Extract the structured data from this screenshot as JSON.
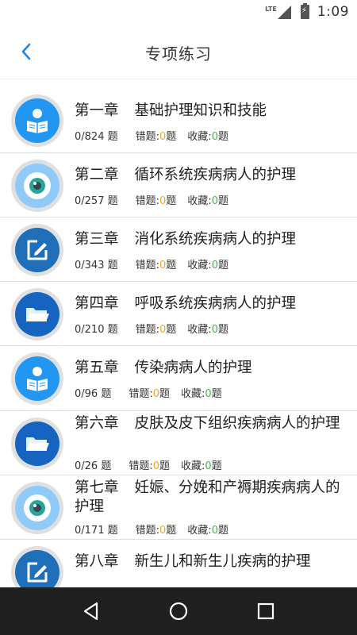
{
  "status_bar": {
    "network": "LTE",
    "time": "1:09"
  },
  "header": {
    "title": "专项练习",
    "back_icon": "chevron-left-icon",
    "accent_color": "#1e88e5"
  },
  "chapters": [
    {
      "chapter": "第一章",
      "title": "基础护理知识和技能",
      "progress": "0/824 题",
      "wrong_label": "错题:",
      "wrong_count": "0",
      "wrong_suffix": "题",
      "fav_label": "收藏:",
      "fav_count": "0",
      "fav_suffix": "题",
      "icon": "reading-book-icon"
    },
    {
      "chapter": "第二章",
      "title": "循环系统疾病病人的护理",
      "progress": "0/257 题",
      "wrong_label": "错题:",
      "wrong_count": "0",
      "wrong_suffix": "题",
      "fav_label": "收藏:",
      "fav_count": "0",
      "fav_suffix": "题",
      "icon": "eye-icon"
    },
    {
      "chapter": "第三章",
      "title": "消化系统疾病病人的护理",
      "progress": "0/343 题",
      "wrong_label": "错题:",
      "wrong_count": "0",
      "wrong_suffix": "题",
      "fav_label": "收藏:",
      "fav_count": "0",
      "fav_suffix": "题",
      "icon": "edit-icon"
    },
    {
      "chapter": "第四章",
      "title": "呼吸系统疾病病人的护理",
      "progress": "0/210 题",
      "wrong_label": "错题:",
      "wrong_count": "0",
      "wrong_suffix": "题",
      "fav_label": "收藏:",
      "fav_count": "0",
      "fav_suffix": "题",
      "icon": "folder-icon"
    },
    {
      "chapter": "第五章",
      "title": "传染病病人的护理",
      "progress": "0/96 题",
      "wrong_label": "错题:",
      "wrong_count": "0",
      "wrong_suffix": "题",
      "fav_label": "收藏:",
      "fav_count": "0",
      "fav_suffix": "题",
      "icon": "reading-book-icon"
    },
    {
      "chapter": "第六章",
      "title": "皮肤及皮下组织疾病病人的护理",
      "progress": "0/26 题",
      "wrong_label": "错题:",
      "wrong_count": "0",
      "wrong_suffix": "题",
      "fav_label": "收藏:",
      "fav_count": "0",
      "fav_suffix": "题",
      "icon": "folder-icon"
    },
    {
      "chapter": "第七章",
      "title": "妊娠、分娩和产褥期疾病病人的护理",
      "progress": "0/171 题",
      "wrong_label": "错题:",
      "wrong_count": "0",
      "wrong_suffix": "题",
      "fav_label": "收藏:",
      "fav_count": "0",
      "fav_suffix": "题",
      "icon": "eye-icon"
    },
    {
      "chapter": "第八章",
      "title": "新生儿和新生儿疾病的护理",
      "icon": "edit-icon"
    }
  ],
  "nav": {
    "back": "back-triangle-icon",
    "home": "home-circle-icon",
    "recents": "recents-square-icon"
  }
}
